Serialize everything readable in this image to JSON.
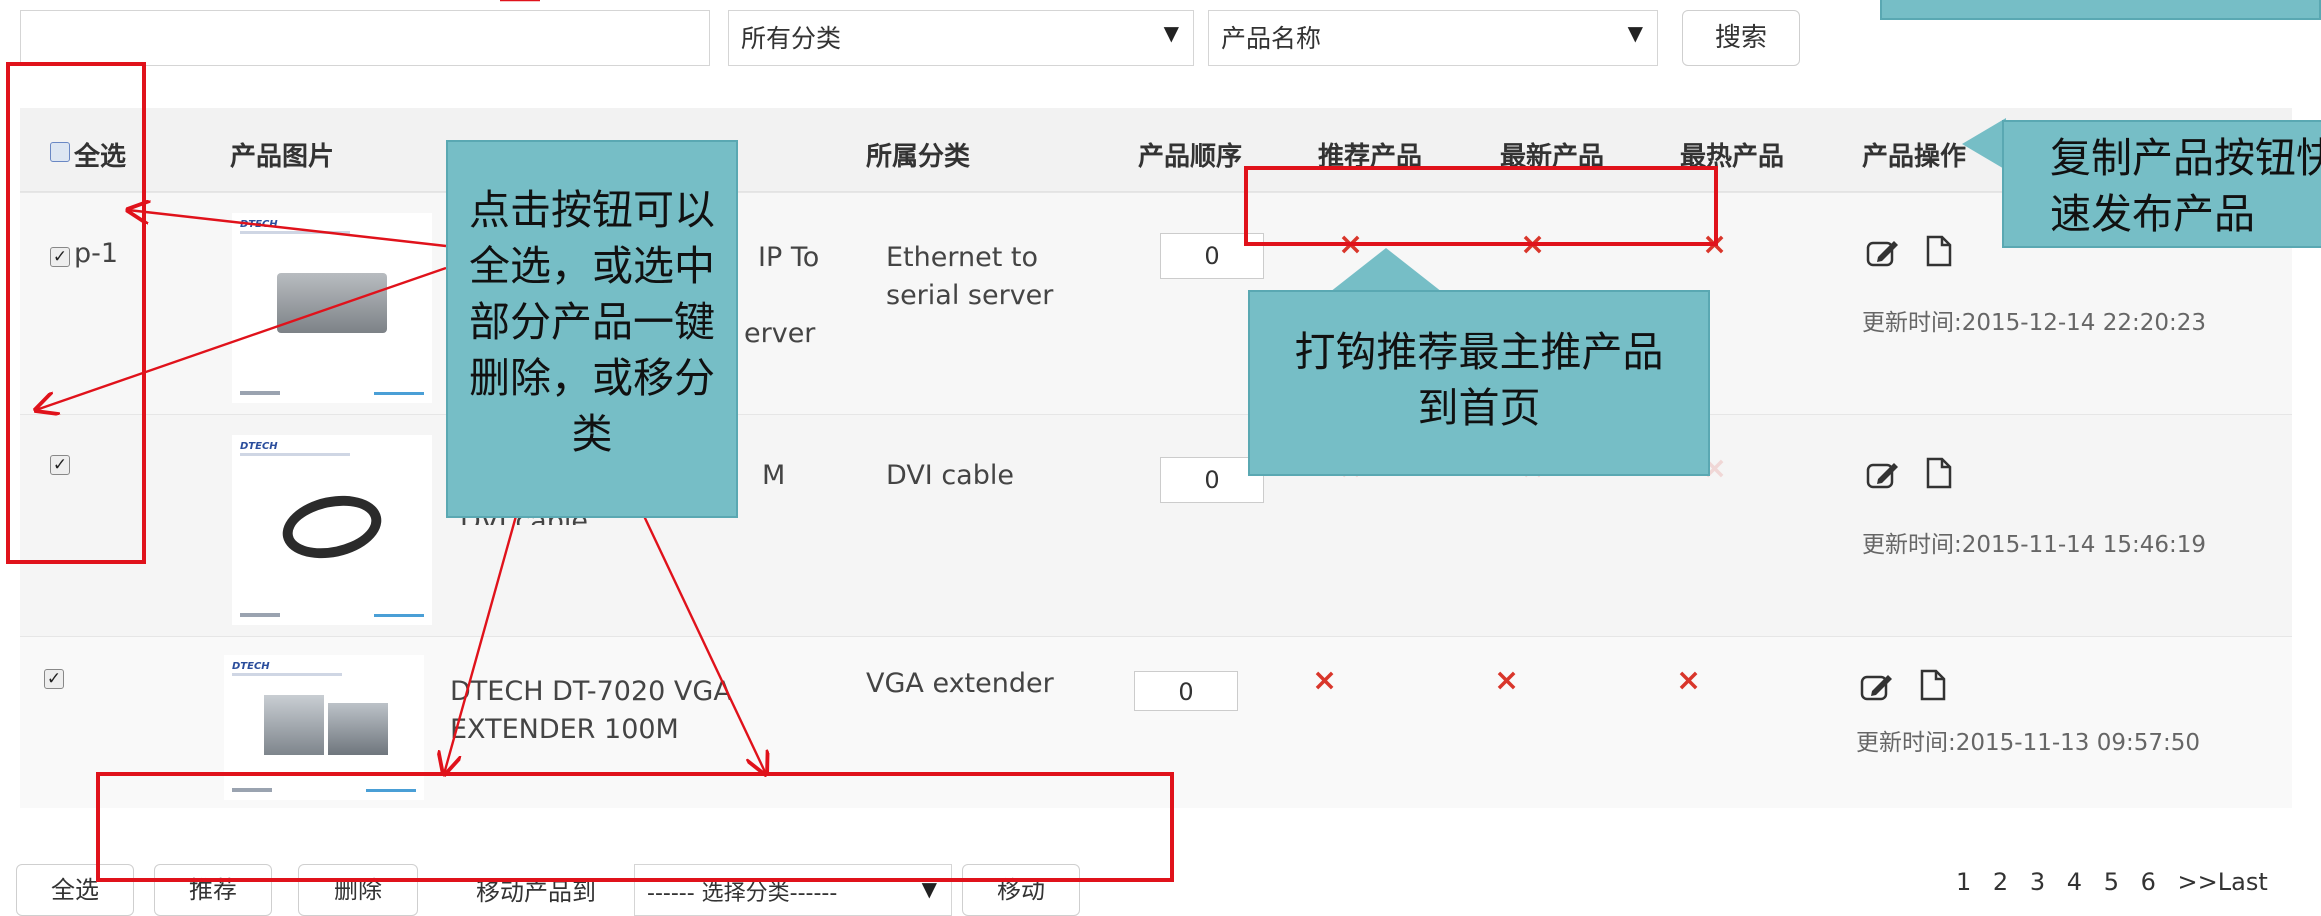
{
  "search": {
    "category_select": "所有分类",
    "field_select": "产品名称",
    "search_button": "搜索"
  },
  "table": {
    "headers": {
      "select_all": "全选",
      "image": "产品图片",
      "category": "所属分类",
      "order": "产品顺序",
      "recommended": "推荐产品",
      "newest": "最新产品",
      "hottest": "最热产品",
      "operations": "产品操作"
    },
    "rows": [
      {
        "label": "p-1",
        "name_line1": "IP To",
        "name_line2": "erver",
        "category": "Ethernet to serial server",
        "order": "0",
        "updated": "更新时间:2015-12-14 22:20:23",
        "rec": "×",
        "new": "×",
        "hot": "×"
      },
      {
        "label": "",
        "name_line1": "M",
        "name_line2": "DVI cable",
        "category": "DVI cable",
        "order": "0",
        "updated": "更新时间:2015-11-14 15:46:19",
        "rec": "×",
        "new": "×",
        "hot": "×"
      },
      {
        "label": "",
        "name_line1": "DTECH DT-7020 VGA",
        "name_line2": "EXTENDER 100M",
        "category": "VGA extender",
        "order": "0",
        "updated": "更新时间:2015-11-13 09:57:50",
        "rec": "×",
        "new": "×",
        "hot": "×"
      }
    ]
  },
  "callouts": {
    "select_all_tip": "点击按钮可以全选，或选中部分产品一键删除，或移分类",
    "recommend_tip": "打钩推荐最主推产品到首页",
    "copy_tip": "复制产品按钮快速发布产品"
  },
  "toolbar": {
    "select_all": "全选",
    "recommend": "推荐",
    "delete": "删除",
    "move_to_label": "移动产品到",
    "move_select": "------ 选择分类------",
    "move_button": "移动"
  },
  "pagination": {
    "pages": [
      "1",
      "2",
      "3",
      "4",
      "5",
      "6"
    ],
    "last": ">>Last"
  },
  "colors": {
    "callout": "#76bec6",
    "highlight": "#e0121b",
    "x_mark": "#d9362b"
  }
}
